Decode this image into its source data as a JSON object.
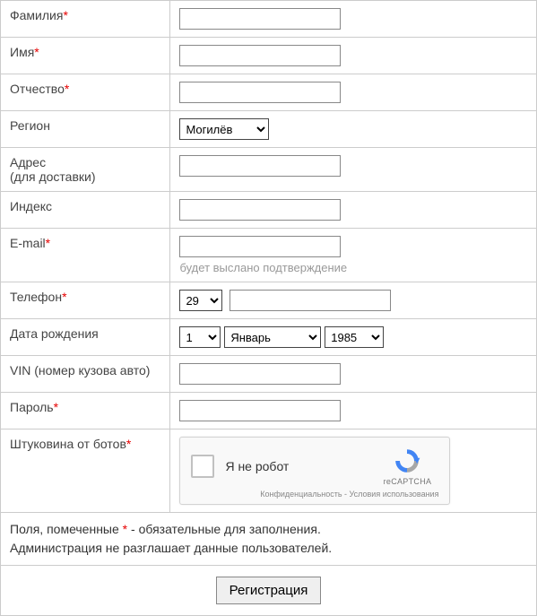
{
  "fields": {
    "lastname": {
      "label": "Фамилия",
      "required": true,
      "value": ""
    },
    "firstname": {
      "label": "Имя",
      "required": true,
      "value": ""
    },
    "patronymic": {
      "label": "Отчество",
      "required": true,
      "value": ""
    },
    "region": {
      "label": "Регион",
      "required": false,
      "selected": "Могилёв",
      "options": [
        "Могилёв"
      ]
    },
    "address": {
      "label": "Адрес",
      "sublabel": "(для доставки)",
      "required": false,
      "value": ""
    },
    "postcode": {
      "label": "Индекс",
      "required": false,
      "value": ""
    },
    "email": {
      "label": "E-mail",
      "required": true,
      "value": "",
      "hint": "будет выслано подтверждение"
    },
    "phone": {
      "label": "Телефон",
      "required": true,
      "code_selected": "29",
      "code_options": [
        "29"
      ],
      "number": ""
    },
    "dob": {
      "label": "Дата рождения",
      "required": false,
      "day_selected": "1",
      "day_options": [
        "1"
      ],
      "month_selected": "Январь",
      "month_options": [
        "Январь"
      ],
      "year_selected": "1985",
      "year_options": [
        "1985"
      ]
    },
    "vin": {
      "label": "VIN (номер кузова авто)",
      "required": false,
      "value": ""
    },
    "password": {
      "label": "Пароль",
      "required": true,
      "value": ""
    },
    "captcha": {
      "label": "Штуковина от ботов",
      "required": true
    }
  },
  "recaptcha": {
    "label": "Я не робот",
    "brand": "reCAPTCHA",
    "privacy": "Конфиденциальность",
    "terms": "Условия использования",
    "separator": " - "
  },
  "footer": {
    "line1_prefix": "Поля, помеченные ",
    "line1_mark": "*",
    "line1_suffix": " - обязательные для заполнения.",
    "line2": "Администрация не разглашает данные пользователей."
  },
  "submit_label": "Регистрация",
  "asterisk": "*"
}
